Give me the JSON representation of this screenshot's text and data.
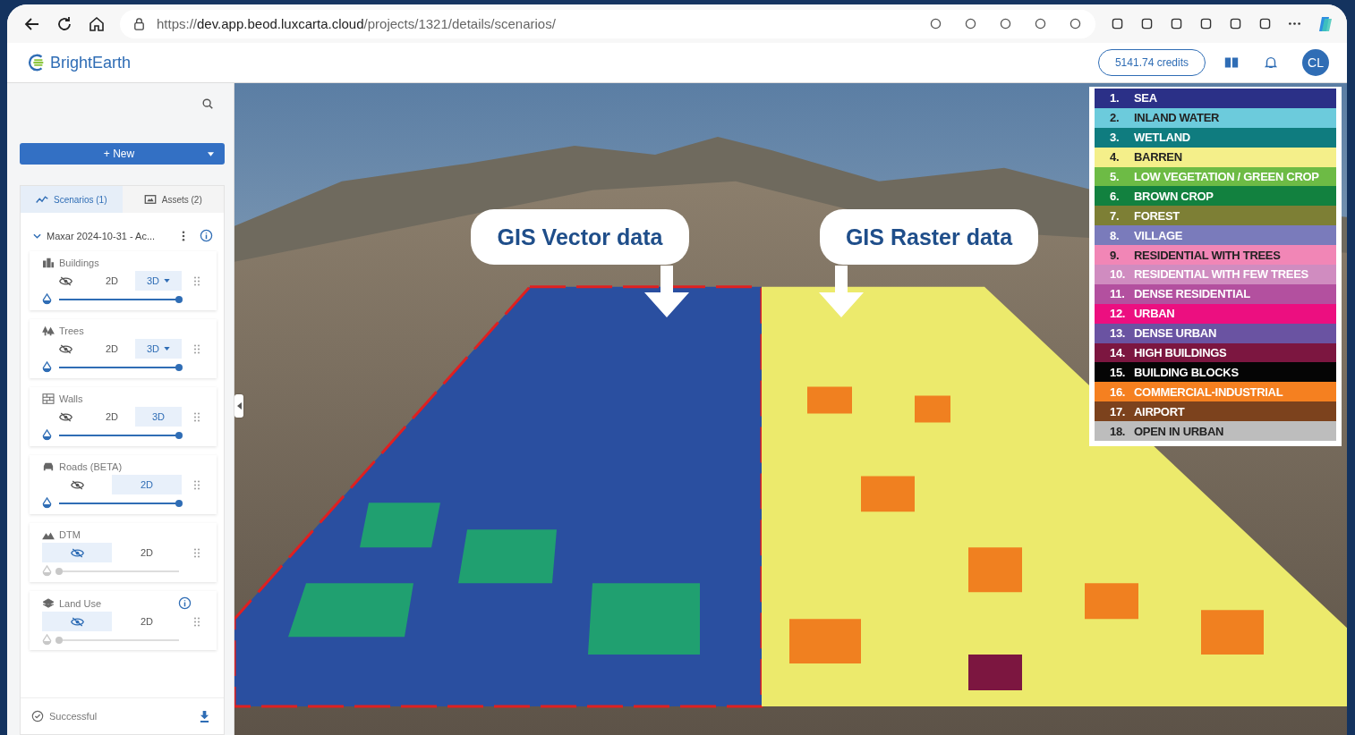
{
  "browser": {
    "url": "https://**dev.app.beod.luxcarta.cloud**/projects/1321/details/scenarios/"
  },
  "header": {
    "logo": "BrightEarth",
    "credits": "5141.74 credits",
    "avatar": "CL"
  },
  "sidebar": {
    "new_button": "+ New",
    "tabs": [
      {
        "label": "Scenarios (1)",
        "selected": true
      },
      {
        "label": "Assets (2)",
        "selected": false
      }
    ],
    "scenario": {
      "title": "Maxar 2024-10-31 - Ac...",
      "expanded": true
    },
    "layers": [
      {
        "name": "Buildings",
        "info": false,
        "enabled": true,
        "level": 1,
        "modes": [
          {
            "kind": "hide",
            "selected": false
          },
          {
            "kind": "label",
            "label": "2D",
            "selected": false,
            "dropdown": false
          },
          {
            "kind": "label",
            "label": "3D",
            "selected": true,
            "dropdown": true
          }
        ]
      },
      {
        "name": "Trees",
        "info": false,
        "enabled": true,
        "level": 1,
        "modes": [
          {
            "kind": "hide",
            "selected": false
          },
          {
            "kind": "label",
            "label": "2D",
            "selected": false,
            "dropdown": false
          },
          {
            "kind": "label",
            "label": "3D",
            "selected": true,
            "dropdown": true
          }
        ]
      },
      {
        "name": "Walls",
        "info": false,
        "enabled": true,
        "level": 1,
        "modes": [
          {
            "kind": "hide",
            "selected": false
          },
          {
            "kind": "label",
            "label": "2D",
            "selected": false,
            "dropdown": false
          },
          {
            "kind": "label",
            "label": "3D",
            "selected": true,
            "dropdown": false
          }
        ]
      },
      {
        "name": "Roads (BETA)",
        "info": false,
        "enabled": true,
        "level": 1,
        "modes": [
          {
            "kind": "hide",
            "selected": false
          },
          {
            "kind": "label",
            "label": "2D",
            "selected": true,
            "dropdown": false
          }
        ]
      },
      {
        "name": "DTM",
        "info": false,
        "enabled": false,
        "level": 0,
        "modes": [
          {
            "kind": "hide",
            "selected": true
          },
          {
            "kind": "label",
            "label": "2D",
            "selected": false,
            "dropdown": false
          }
        ]
      },
      {
        "name": "Land Use",
        "info": true,
        "enabled": false,
        "level": 0,
        "modes": [
          {
            "kind": "hide",
            "selected": true
          },
          {
            "kind": "label",
            "label": "2D",
            "selected": false,
            "dropdown": false
          }
        ]
      }
    ],
    "status": "Successful"
  },
  "map": {
    "callouts": [
      "GIS Vector data",
      "GIS Raster data"
    ],
    "legend": [
      {
        "number": "1.",
        "label": "SEA",
        "color": "#2b3087"
      },
      {
        "number": "2.",
        "label": "INLAND WATER",
        "color": "#6ccbdc"
      },
      {
        "number": "3.",
        "label": "WETLAND",
        "color": "#0f7c7f"
      },
      {
        "number": "4.",
        "label": "BARREN",
        "color": "#f4ef8a"
      },
      {
        "number": "5.",
        "label": "LOW VEGETATION / GREEN CROP",
        "color": "#6dbb45"
      },
      {
        "number": "6.",
        "label": "BROWN CROP",
        "color": "#12813f"
      },
      {
        "number": "7.",
        "label": "FOREST",
        "color": "#7d7f35"
      },
      {
        "number": "8.",
        "label": "VILLAGE",
        "color": "#7a7bbb"
      },
      {
        "number": "9.",
        "label": "RESIDENTIAL WITH TREES",
        "color": "#f186b6"
      },
      {
        "number": "10.",
        "label": "RESIDENTIAL WITH FEW TREES",
        "color": "#d08cc0"
      },
      {
        "number": "11.",
        "label": "DENSE RESIDENTIAL",
        "color": "#b3509f"
      },
      {
        "number": "12.",
        "label": "URBAN",
        "color": "#ec0f80"
      },
      {
        "number": "13.",
        "label": "DENSE URBAN",
        "color": "#6a53a2"
      },
      {
        "number": "14.",
        "label": "HIGH BUILDINGS",
        "color": "#7c1640"
      },
      {
        "number": "15.",
        "label": "BUILDING BLOCKS",
        "color": "#050505"
      },
      {
        "number": "16.",
        "label": "COMMERCIAL-INDUSTRIAL",
        "color": "#f58020"
      },
      {
        "number": "17.",
        "label": "AIRPORT",
        "color": "#7c421d"
      },
      {
        "number": "18.",
        "label": "OPEN IN URBAN",
        "color": "#bdbdbd"
      }
    ]
  }
}
